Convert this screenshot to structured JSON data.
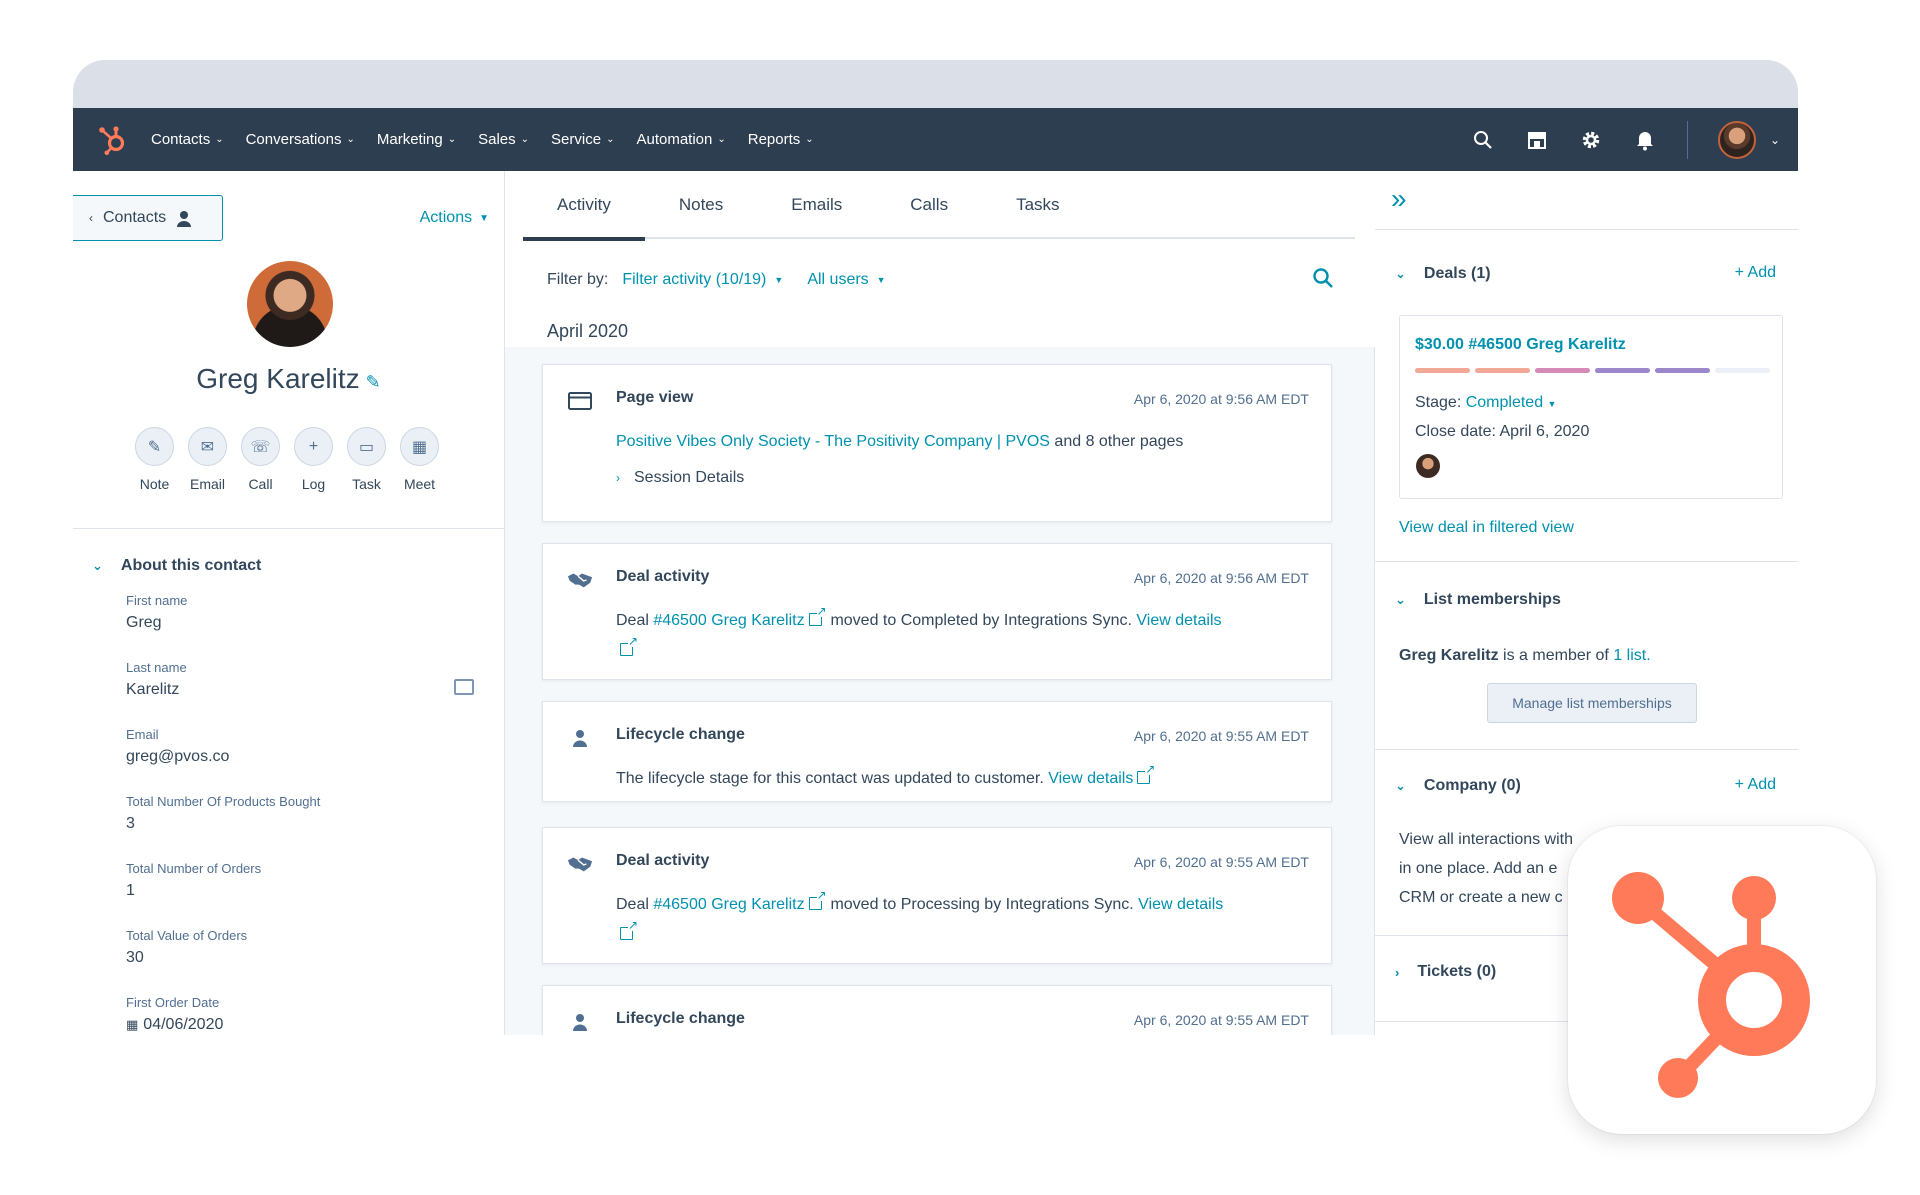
{
  "nav": {
    "items": [
      "Contacts",
      "Conversations",
      "Marketing",
      "Sales",
      "Service",
      "Automation",
      "Reports"
    ]
  },
  "left": {
    "back_label": "Contacts",
    "actions_label": "Actions",
    "contact_name": "Greg Karelitz",
    "quick_actions": [
      "Note",
      "Email",
      "Call",
      "Log",
      "Task",
      "Meet"
    ],
    "about_title": "About this contact",
    "properties": [
      {
        "label": "First name",
        "value": "Greg"
      },
      {
        "label": "Last name",
        "value": "Karelitz"
      },
      {
        "label": "Email",
        "value": "greg@pvos.co"
      },
      {
        "label": "Total Number Of Products Bought",
        "value": "3"
      },
      {
        "label": "Total Number of Orders",
        "value": "1"
      },
      {
        "label": "Total Value of Orders",
        "value": "30"
      },
      {
        "label": "First Order Date",
        "value": "04/06/2020"
      }
    ]
  },
  "middle": {
    "tabs": [
      "Activity",
      "Notes",
      "Emails",
      "Calls",
      "Tasks"
    ],
    "active_tab": "Activity",
    "filter_label": "Filter by:",
    "filter_activity": "Filter activity (10/19)",
    "filter_users": "All users",
    "month": "April 2020",
    "events": [
      {
        "title": "Page view",
        "time": "Apr 6, 2020 at 9:56 AM EDT",
        "link": "Positive Vibes Only Society - The Positivity Company | PVOS",
        "text": "and 8 other pages",
        "session": "Session Details"
      },
      {
        "title": "Deal activity",
        "time": "Apr 6, 2020 at 9:56 AM EDT",
        "prefix": "Deal",
        "link": "#46500 Greg Karelitz",
        "text": "moved to Completed by Integrations Sync.",
        "details": "View details"
      },
      {
        "title": "Lifecycle change",
        "time": "Apr 6, 2020 at 9:55 AM EDT",
        "text": "The lifecycle stage for this contact was updated to customer.",
        "details": "View details"
      },
      {
        "title": "Deal activity",
        "time": "Apr 6, 2020 at 9:55 AM EDT",
        "prefix": "Deal",
        "link": "#46500 Greg Karelitz",
        "text": "moved to Processing by Integrations Sync.",
        "details": "View details"
      },
      {
        "title": "Lifecycle change",
        "time": "Apr 6, 2020 at 9:55 AM EDT"
      }
    ]
  },
  "right": {
    "deals_title": "Deals (1)",
    "add_label": "+ Add",
    "deal": {
      "title": "$30.00 #46500 Greg Karelitz",
      "stage_label": "Stage:",
      "stage_value": "Completed",
      "close_label": "Close date:",
      "close_value": "April 6, 2020",
      "pipeline_colors": [
        "#f2a896",
        "#f2a896",
        "#d48bb8",
        "#9b87c9",
        "#9b87c9",
        "#eaf0f6"
      ]
    },
    "view_deal": "View deal in filtered view",
    "lists_title": "List memberships",
    "list_name": "Greg Karelitz",
    "list_mid": "is a member of",
    "list_link": "1 list.",
    "manage_btn": "Manage list memberships",
    "company_title": "Company (0)",
    "company_lines": [
      "View all interactions with",
      "in one place. Add an e",
      "CRM or create a new c"
    ],
    "tickets_title": "Tickets (0)"
  },
  "colors": {
    "nav_bg": "#2d3e50",
    "link": "#0091ae",
    "brand": "#ff7a59"
  },
  "icons": [
    "hubspot-logo-icon",
    "search-icon",
    "marketplace-icon",
    "gear-icon",
    "bell-icon"
  ]
}
